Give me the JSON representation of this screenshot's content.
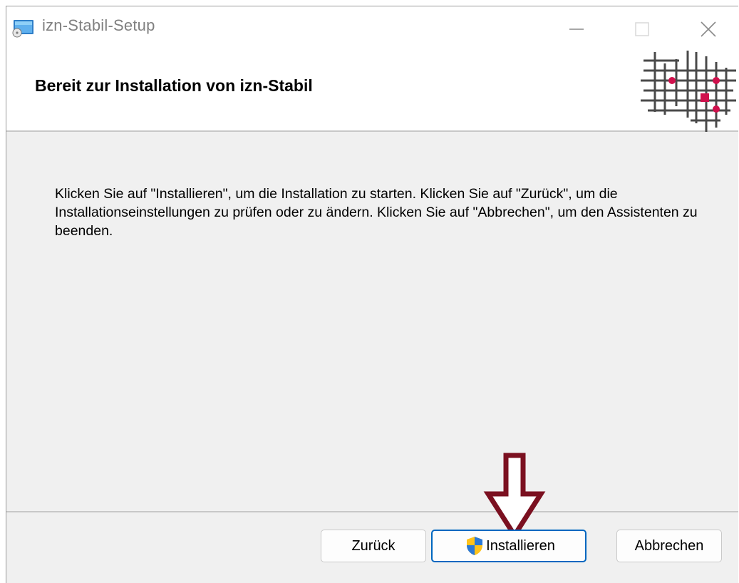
{
  "window": {
    "title": "izn-Stabil-Setup",
    "controls": {
      "minimize_icon": "minimize-icon",
      "maximize_icon": "maximize-icon",
      "close_icon": "close-icon"
    }
  },
  "banner": {
    "title": "Bereit zur Installation von izn-Stabil",
    "logo_icon": "grid-logo-icon"
  },
  "body": {
    "instructions": "Klicken Sie auf \"Installieren\", um die Installation zu starten. Klicken Sie auf \"Zurück\", um die Installationseinstellungen zu prüfen oder zu ändern. Klicken Sie auf \"Abbrechen\", um den Assistenten zu beenden."
  },
  "buttons": {
    "back_label": "Zurück",
    "install_label": "Installieren",
    "cancel_label": "Abbrechen",
    "install_icon": "uac-shield-icon"
  },
  "annotation": {
    "arrow_icon": "down-arrow-icon",
    "arrow_color": "#7b1020"
  },
  "colors": {
    "accent": "#0067c0",
    "logo_accent": "#d0104c",
    "dialog_background": "#f0f0f0"
  }
}
